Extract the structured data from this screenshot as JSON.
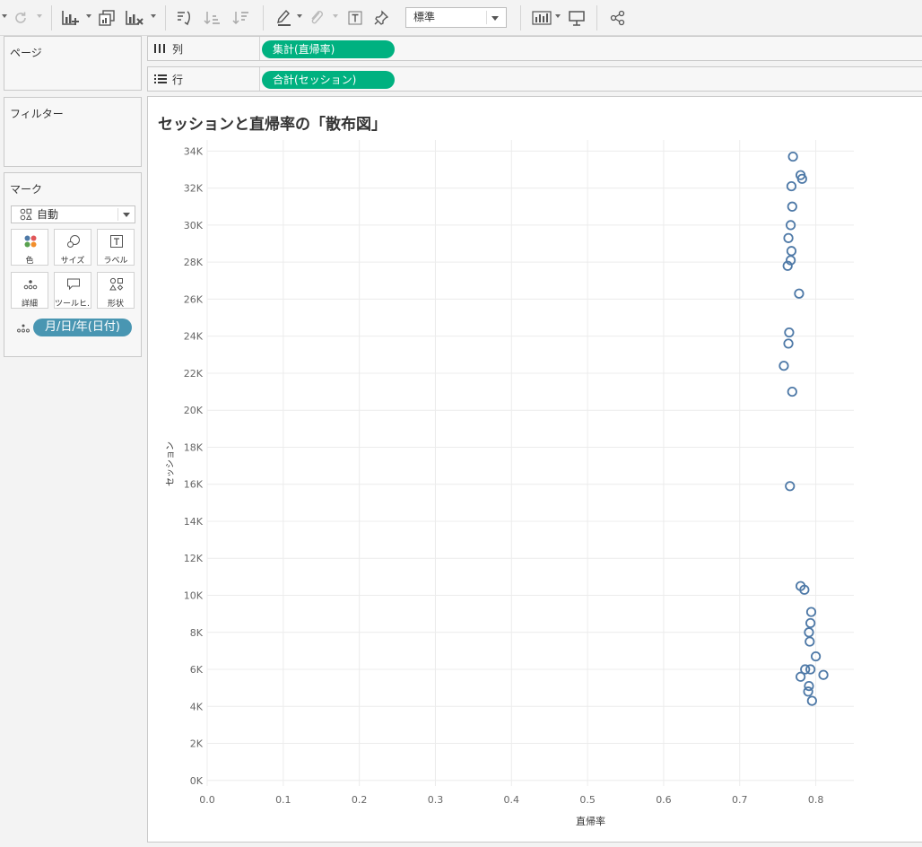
{
  "toolbar": {
    "icons": [
      "chevron-left-icon",
      "redo-icon",
      "new-worksheet-icon",
      "duplicate-sheet-icon",
      "clear-sheet-icon",
      "swap-axes-icon",
      "sort-ascending-icon",
      "sort-descending-icon",
      "highlight-icon",
      "group-icon",
      "text-label-icon",
      "pin-icon",
      "show-me-icon",
      "presentation-icon",
      "share-icon"
    ],
    "fit_select": "標準"
  },
  "panels": {
    "pages": {
      "title": "ページ"
    },
    "filters": {
      "title": "フィルター"
    },
    "marks": {
      "title": "マーク",
      "type": "自動",
      "buttons": [
        {
          "label": "色",
          "icon": "color-icon"
        },
        {
          "label": "サイズ",
          "icon": "size-icon"
        },
        {
          "label": "ラベル",
          "icon": "label-icon"
        },
        {
          "label": "詳細",
          "icon": "detail-icon"
        },
        {
          "label": "ツールヒ…",
          "icon": "tooltip-icon"
        },
        {
          "label": "形状",
          "icon": "shape-icon"
        }
      ],
      "detail_pill": "月/日/年(日付)"
    }
  },
  "shelves": {
    "columns": {
      "label": "列",
      "pill": "集計(直帰率)",
      "pill_color": "#00b180"
    },
    "rows": {
      "label": "行",
      "pill": "合計(セッション)",
      "pill_color": "#00b180"
    }
  },
  "view": {
    "title": "セッションと直帰率の「散布図」"
  },
  "chart_data": {
    "type": "scatter",
    "xlabel": "直帰率",
    "ylabel": "セッション",
    "xlim": [
      0,
      0.85
    ],
    "ylim": [
      -300,
      34600
    ],
    "x_ticks": [
      "0.0",
      "0.1",
      "0.2",
      "0.3",
      "0.4",
      "0.5",
      "0.6",
      "0.7",
      "0.8"
    ],
    "y_ticks": [
      "0K",
      "2K",
      "4K",
      "6K",
      "8K",
      "10K",
      "12K",
      "14K",
      "16K",
      "18K",
      "20K",
      "22K",
      "24K",
      "26K",
      "28K",
      "30K",
      "32K",
      "34K"
    ],
    "grid": true,
    "marker": "circle-open",
    "color": "#4e79a7",
    "points": [
      [
        0.77,
        33700
      ],
      [
        0.78,
        32700
      ],
      [
        0.782,
        32500
      ],
      [
        0.768,
        32100
      ],
      [
        0.769,
        31000
      ],
      [
        0.767,
        30000
      ],
      [
        0.764,
        29300
      ],
      [
        0.768,
        28600
      ],
      [
        0.767,
        28100
      ],
      [
        0.763,
        27800
      ],
      [
        0.778,
        26300
      ],
      [
        0.765,
        24200
      ],
      [
        0.764,
        23600
      ],
      [
        0.758,
        22400
      ],
      [
        0.769,
        21000
      ],
      [
        0.766,
        15900
      ],
      [
        0.78,
        10500
      ],
      [
        0.785,
        10300
      ],
      [
        0.794,
        9100
      ],
      [
        0.793,
        8500
      ],
      [
        0.791,
        8000
      ],
      [
        0.792,
        7500
      ],
      [
        0.8,
        6700
      ],
      [
        0.786,
        6000
      ],
      [
        0.793,
        6000
      ],
      [
        0.81,
        5700
      ],
      [
        0.78,
        5600
      ],
      [
        0.791,
        5100
      ],
      [
        0.79,
        4800
      ],
      [
        0.795,
        4300
      ]
    ]
  }
}
